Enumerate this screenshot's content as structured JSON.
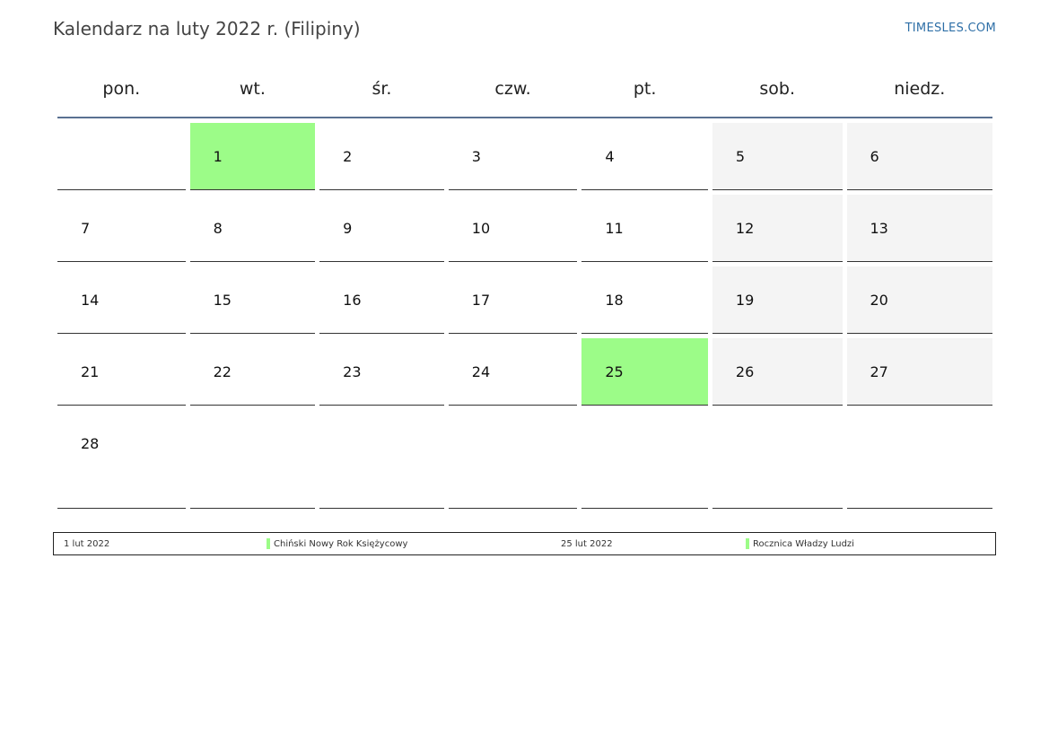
{
  "header": {
    "title": "Kalendarz na luty 2022 r. (Filipiny)",
    "brand": "TIMESLES.COM"
  },
  "colors": {
    "holiday": "#9cfc88",
    "weekend": "#f4f4f4",
    "rule": "#5a7191",
    "brand": "#2e6fa7"
  },
  "weekdays": [
    "pon.",
    "wt.",
    "śr.",
    "czw.",
    "pt.",
    "sob.",
    "niedz."
  ],
  "weeks": [
    [
      "",
      "1",
      "2",
      "3",
      "4",
      "5",
      "6"
    ],
    [
      "7",
      "8",
      "9",
      "10",
      "11",
      "12",
      "13"
    ],
    [
      "14",
      "15",
      "16",
      "17",
      "18",
      "19",
      "20"
    ],
    [
      "21",
      "22",
      "23",
      "24",
      "25",
      "26",
      "27"
    ],
    [
      "28",
      "",
      "",
      "",
      "",
      "",
      ""
    ]
  ],
  "holidays": [
    "1",
    "25"
  ],
  "legend": {
    "items": [
      {
        "date": "1 lut 2022",
        "name": "Chiński Nowy Rok Księżycowy"
      },
      {
        "date": "25 lut 2022",
        "name": "Rocznica Władzy Ludzi"
      }
    ]
  }
}
